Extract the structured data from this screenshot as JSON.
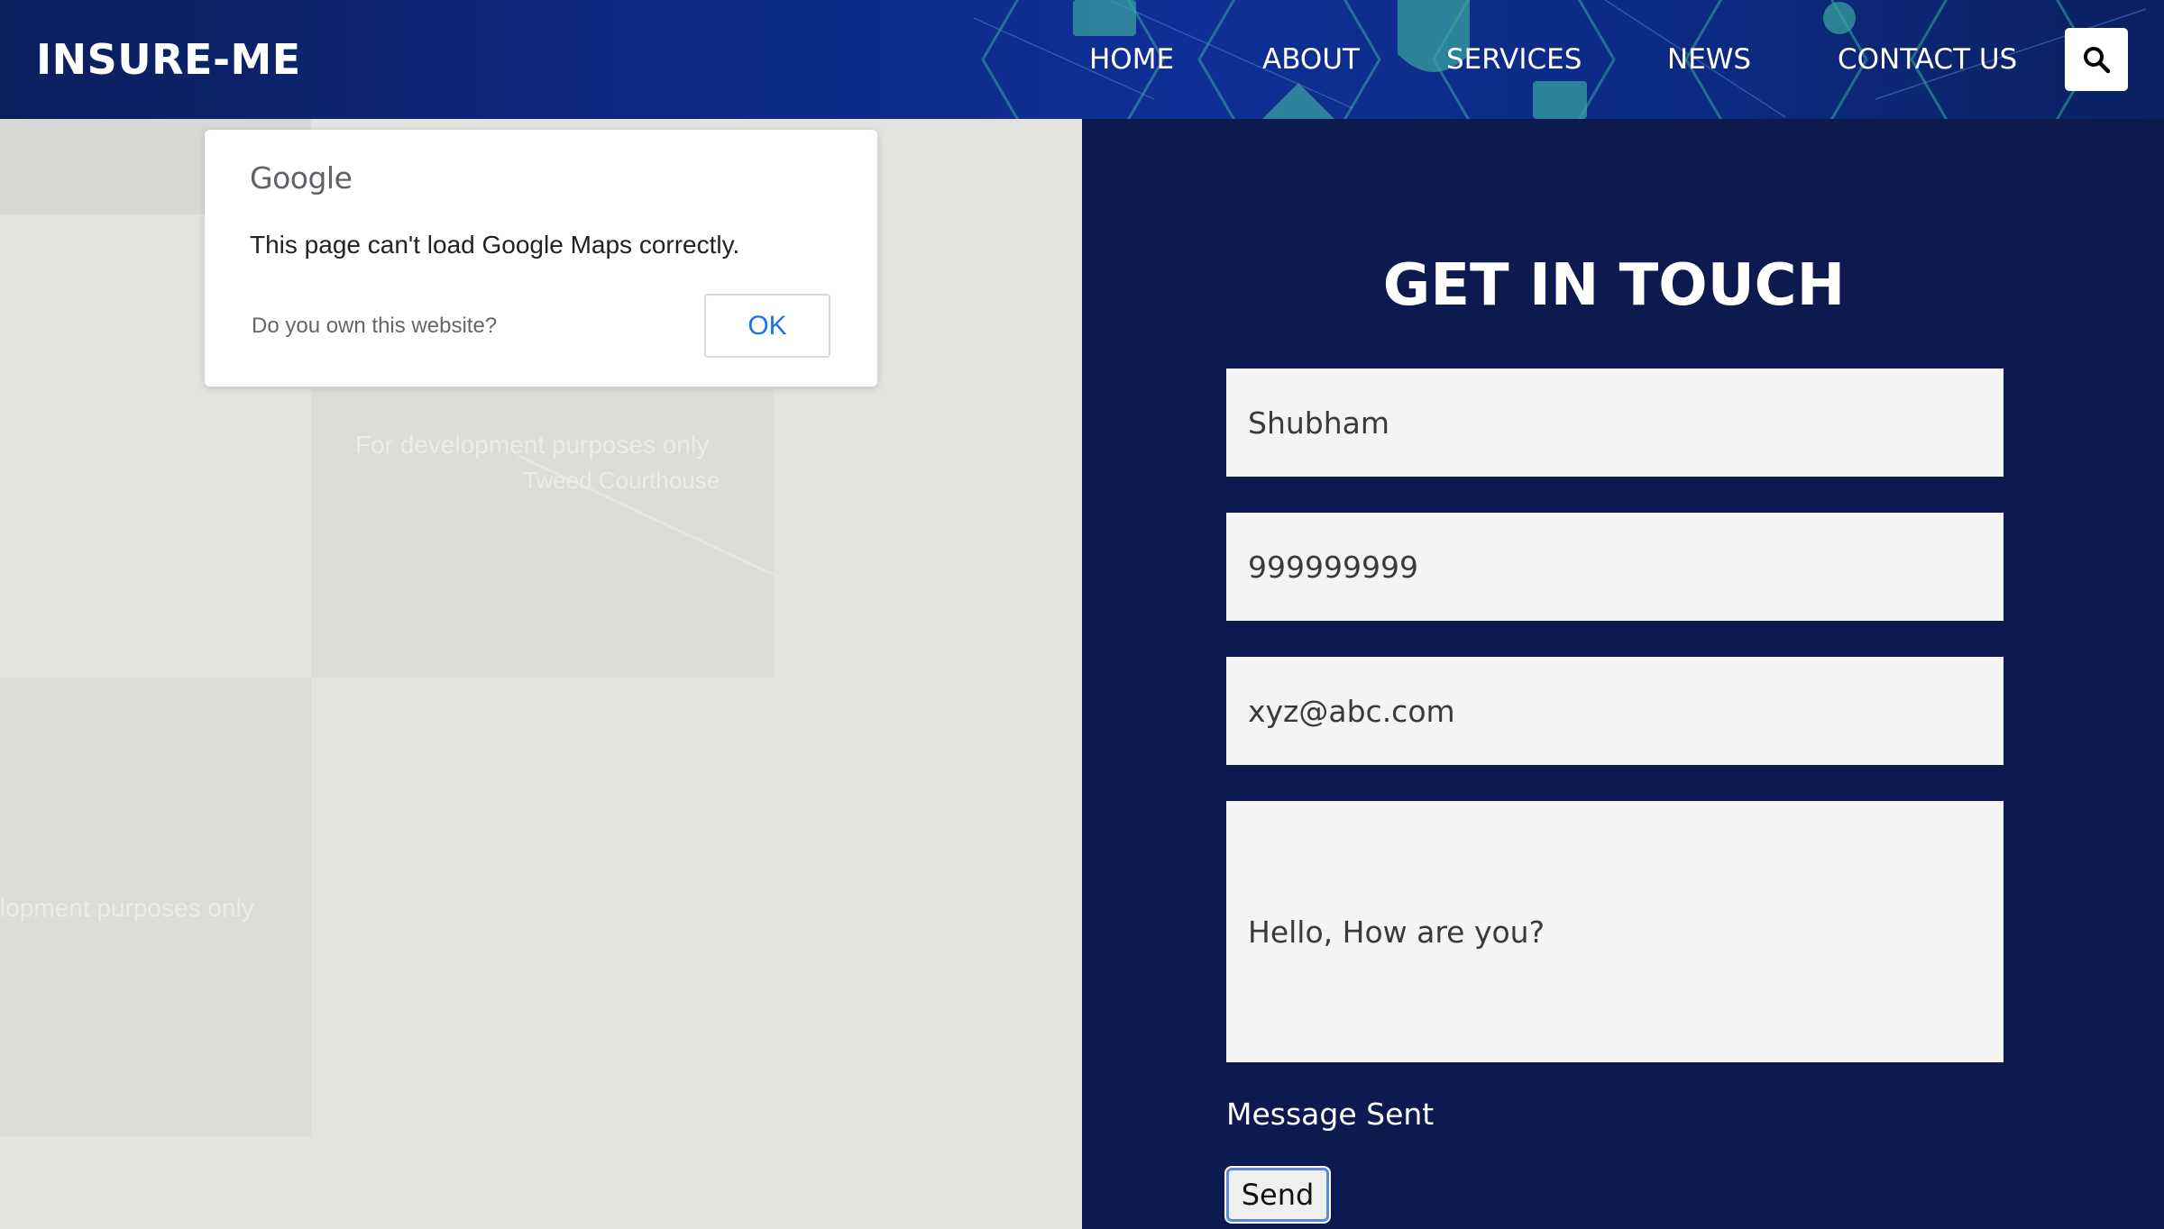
{
  "header": {
    "brand": "INSURE-ME",
    "nav": [
      {
        "label": "HOME"
      },
      {
        "label": "ABOUT"
      },
      {
        "label": "SERVICES"
      },
      {
        "label": "NEWS"
      },
      {
        "label": "CONTACT US"
      }
    ],
    "search_icon": "search-icon"
  },
  "map": {
    "dialog": {
      "logo": "Google",
      "message": "This page can't load Google Maps correctly.",
      "own_site": "Do you own this website?",
      "ok_label": "OK"
    },
    "ghost_text": {
      "dev_only": "For development purposes only",
      "place_1": "Tweed Courthouse",
      "dev_only_partial": "lopment purposes only"
    }
  },
  "contact": {
    "title": "GET IN TOUCH",
    "fields": {
      "name": "Shubham",
      "phone": "999999999",
      "email": "xyz@abc.com",
      "message": "Hello, How are you?"
    },
    "status": "Message Sent",
    "send_label": "Send"
  },
  "colors": {
    "panel_bg": "#0d1a50",
    "header_bg": "#0c2a86",
    "accent_link": "#1a73e8"
  }
}
